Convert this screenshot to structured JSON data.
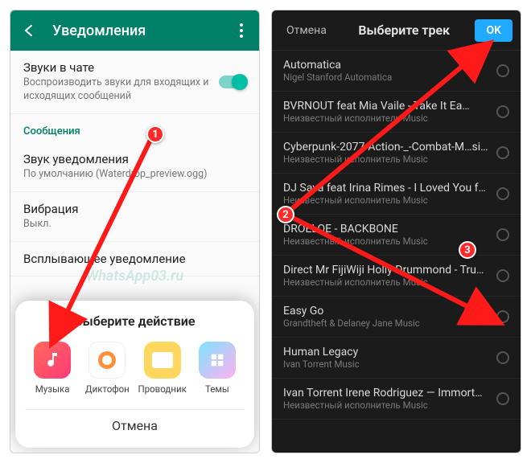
{
  "watermark": "WhatsApp03.ru",
  "left": {
    "header_title": "Уведомления",
    "sounds": {
      "title": "Звуки в чате",
      "subtitle": "Воспроизводить звуки для входящих и исходящих сообщений"
    },
    "section_messages": "Сообщения",
    "notif_sound": {
      "title": "Звук уведомления",
      "subtitle": "По умолчанию (Waterdrop_preview.ogg)"
    },
    "vibration": {
      "title": "Вибрация",
      "subtitle": "Выкл."
    },
    "popup": {
      "title": "Всплывающее уведомление"
    },
    "sheet": {
      "title": "Выберите действие",
      "apps": [
        {
          "label": "Музыка",
          "icon": "music"
        },
        {
          "label": "Диктофон",
          "icon": "recorder"
        },
        {
          "label": "Проводник",
          "icon": "files"
        },
        {
          "label": "Темы",
          "icon": "themes"
        }
      ],
      "cancel": "Отмена"
    }
  },
  "right": {
    "cancel": "Отмена",
    "title": "Выберите трек",
    "ok": "OK",
    "tracks": [
      {
        "name": "Automatica",
        "sub": "Nigel Stanford Automatica"
      },
      {
        "name": "BVRNOUT feat Mia Vaile - Take It Ea…",
        "sub": "Неизвестный исполнитель Music"
      },
      {
        "name": "Cyberpunk-2077-Action-_-Combat-M…si…",
        "sub": "Неизвестный исполнитель Music"
      },
      {
        "name": "DJ Sava feat Irina Rimes - I Loved You f…",
        "sub": "Неизвестный исполнитель Music"
      },
      {
        "name": "DROELOE - BACKBONE",
        "sub": "Неизвестный исполнитель Music"
      },
      {
        "name": "Direct Mr FijiWiji Holly Drummond - Trus…",
        "sub": "Неизвестный исполнитель Music"
      },
      {
        "name": "Easy Go",
        "sub": "Grandtheft & Delaney Jane Music"
      },
      {
        "name": "Human Legacy",
        "sub": "Ivan Torrent Music"
      },
      {
        "name": "Ivan Torrent  Irene Rodriguez — Immortal…",
        "sub": "Неизвестный исполнитель Music"
      }
    ]
  },
  "annotations": {
    "n1": "1",
    "n2": "2",
    "n3": "3"
  }
}
